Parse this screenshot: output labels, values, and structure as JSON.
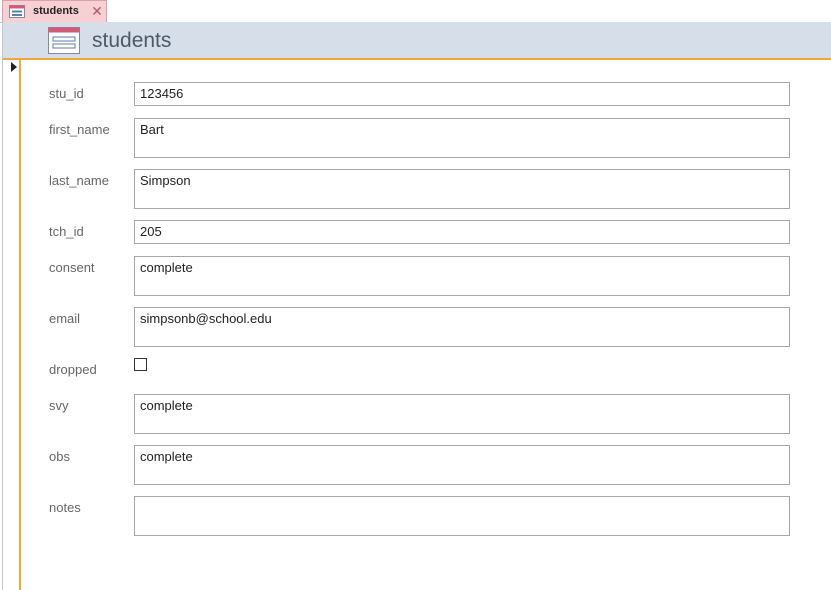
{
  "tab": {
    "label": "students"
  },
  "header": {
    "title": "students"
  },
  "fields": [
    {
      "label": "stu_id",
      "value": "123456"
    },
    {
      "label": "first_name",
      "value": "Bart"
    },
    {
      "label": "last_name",
      "value": "Simpson"
    },
    {
      "label": "tch_id",
      "value": "205"
    },
    {
      "label": "consent",
      "value": "complete"
    },
    {
      "label": "email",
      "value": "simpsonb@school.edu"
    },
    {
      "label": "dropped",
      "checked": false
    },
    {
      "label": "svy",
      "value": "complete"
    },
    {
      "label": "obs",
      "value": "complete"
    },
    {
      "label": "notes",
      "value": ""
    }
  ],
  "colors": {
    "tab_bg": "#f8d0d4",
    "header_bg": "#d6dfe9",
    "accent": "#f2a736"
  },
  "icons": {
    "tab": "form-icon",
    "header": "form-icon",
    "close": "close-icon",
    "selector": "record-selector-arrow-icon"
  }
}
